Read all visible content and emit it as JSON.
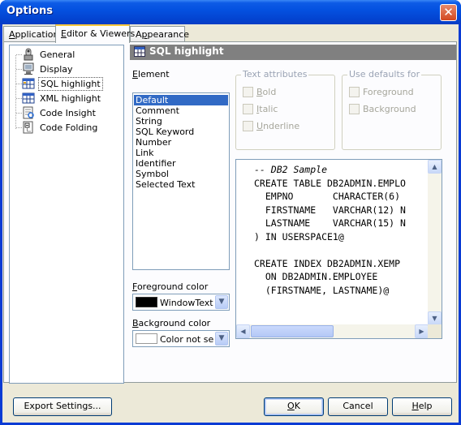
{
  "window": {
    "title": "Options",
    "close_glyph": "✕"
  },
  "tabs": [
    {
      "pre": "",
      "u": "A",
      "post": "pplication"
    },
    {
      "pre": "",
      "u": "E",
      "post": "ditor & Viewers"
    },
    {
      "pre": "A",
      "u": "p",
      "post": "pearance"
    }
  ],
  "tree": {
    "items": [
      {
        "label": "General",
        "icon": "general-icon"
      },
      {
        "label": "Display",
        "icon": "display-icon"
      },
      {
        "label": "SQL highlight",
        "icon": "sql-grid-icon",
        "selected": true
      },
      {
        "label": "XML highlight",
        "icon": "xml-grid-icon"
      },
      {
        "label": "Code Insight",
        "icon": "code-insight-icon"
      },
      {
        "label": "Code Folding",
        "icon": "code-folding-icon"
      }
    ]
  },
  "section": {
    "title": "SQL highlight"
  },
  "element": {
    "label_u": "E",
    "label_rest": "lement",
    "items": [
      "Default",
      "Comment",
      "String",
      "SQL Keyword",
      "Number",
      "Link",
      "Identifier",
      "Symbol",
      "Selected Text"
    ],
    "selected_index": 0
  },
  "text_attributes": {
    "title": "Text attributes",
    "bold": {
      "u": "B",
      "rest": "old"
    },
    "italic": {
      "u": "I",
      "rest": "talic"
    },
    "underline": {
      "u": "U",
      "rest": "nderline"
    }
  },
  "use_defaults": {
    "title": "Use defaults for",
    "foreground": "Foreground",
    "background": "Background"
  },
  "foreground_color": {
    "label_u": "F",
    "label_rest": "oreground color",
    "value": "WindowText",
    "swatch": "#000000"
  },
  "background_color": {
    "label_u": "B",
    "label_rest": "ackground color",
    "value": "Color not sele",
    "swatch": "#ffffff"
  },
  "code_preview": {
    "comment": "-- DB2 Sample",
    "lines": [
      "CREATE TABLE DB2ADMIN.EMPLO",
      "  EMPNO       CHARACTER(6)",
      "  FIRSTNAME   VARCHAR(12) N",
      "  LASTNAME    VARCHAR(15) N",
      ") IN USERSPACE1@",
      "",
      "CREATE INDEX DB2ADMIN.XEMP",
      "  ON DB2ADMIN.EMPLOYEE",
      "  (FIRSTNAME, LASTNAME)@"
    ]
  },
  "buttons": {
    "export": "Export Settings...",
    "ok_u": "O",
    "ok_rest": "K",
    "cancel": "Cancel",
    "help_u": "H",
    "help_rest": "elp"
  },
  "colors": {
    "title_blue": "#0451e0",
    "selection": "#316ac5",
    "panel": "#ece9d8"
  }
}
